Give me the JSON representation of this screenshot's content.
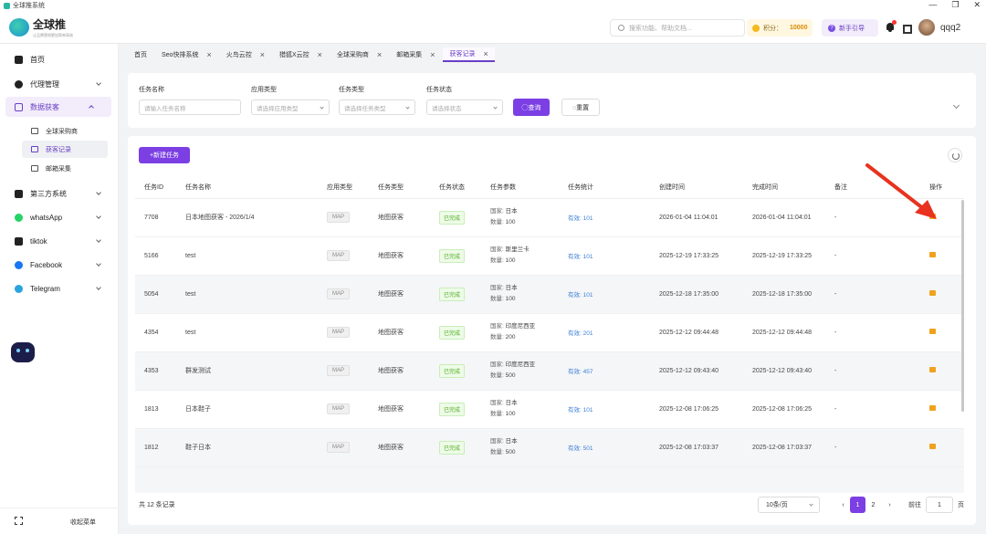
{
  "window": {
    "title": "全球推系统",
    "controls": [
      "—",
      "❐",
      "✕"
    ]
  },
  "brand": {
    "name": "全球推",
    "subtitle": "让品牌营销更加简单高效"
  },
  "header": {
    "search_placeholder": "搜索功能、帮助文档...",
    "points_label": "积分：",
    "points_value": "10000",
    "guide_label": "新手引导",
    "username": "qqq2"
  },
  "sidebar": {
    "items": [
      {
        "label": "首页"
      },
      {
        "label": "代理管理"
      },
      {
        "label": "数据获客"
      },
      {
        "label": "第三方系统"
      },
      {
        "label": "whatsApp"
      },
      {
        "label": "tiktok"
      },
      {
        "label": "Facebook"
      },
      {
        "label": "Telegram"
      }
    ],
    "subitems": [
      {
        "label": "全球采购商"
      },
      {
        "label": "获客记录"
      },
      {
        "label": "邮箱采集"
      }
    ],
    "collapse_label": "收起菜单"
  },
  "tabs": [
    {
      "label": "首页",
      "closable": false
    },
    {
      "label": "Seo快排系统",
      "closable": true
    },
    {
      "label": "火鸟云控",
      "closable": true
    },
    {
      "label": "猎狐X云控",
      "closable": true
    },
    {
      "label": "全球采购商",
      "closable": true
    },
    {
      "label": "邮箱采集",
      "closable": true
    },
    {
      "label": "获客记录",
      "closable": true
    }
  ],
  "filters": {
    "task_name": {
      "label": "任务名称",
      "placeholder": "请输入任务名称"
    },
    "app_type": {
      "label": "应用类型",
      "placeholder": "请选择应用类型"
    },
    "task_type": {
      "label": "任务类型",
      "placeholder": "请选择任务类型"
    },
    "task_status": {
      "label": "任务状态",
      "placeholder": "请选择状态"
    },
    "query_label": "◯查询",
    "reset_label": "◌重置"
  },
  "toolbar": {
    "new_task_label": "+新建任务"
  },
  "table": {
    "headers": [
      "任务ID",
      "任务名称",
      "应用类型",
      "任务类型",
      "任务状态",
      "任务参数",
      "任务统计",
      "创建时间",
      "完成时间",
      "备注",
      "操作"
    ],
    "rows": [
      {
        "id": "7708",
        "name": "日本地图获客 - 2026/1/4",
        "app": "MAP",
        "type": "地图获客",
        "status": "已完成",
        "country_k": "国家:",
        "country": "日本",
        "qty_k": "数量:",
        "qty": "100",
        "stat": "有效: 101",
        "created": "2026-01-04 11:04:01",
        "done": "2026-01-04 11:04:01",
        "note": "-"
      },
      {
        "id": "5166",
        "name": "test",
        "app": "MAP",
        "type": "地图获客",
        "status": "已完成",
        "country_k": "国家:",
        "country": "斯里兰卡",
        "qty_k": "数量:",
        "qty": "100",
        "stat": "有效: 101",
        "created": "2025-12-19 17:33:25",
        "done": "2025-12-19 17:33:25",
        "note": "-"
      },
      {
        "id": "5054",
        "name": "test",
        "app": "MAP",
        "type": "地图获客",
        "status": "已完成",
        "country_k": "国家:",
        "country": "日本",
        "qty_k": "数量:",
        "qty": "100",
        "stat": "有效: 101",
        "created": "2025-12-18 17:35:00",
        "done": "2025-12-18 17:35:00",
        "note": "-"
      },
      {
        "id": "4354",
        "name": "test",
        "app": "MAP",
        "type": "地图获客",
        "status": "已完成",
        "country_k": "国家:",
        "country": "印度尼西亚",
        "qty_k": "数量:",
        "qty": "200",
        "stat": "有效: 201",
        "created": "2025-12-12 09:44:48",
        "done": "2025-12-12 09:44:48",
        "note": "-"
      },
      {
        "id": "4353",
        "name": "群发测试",
        "app": "MAP",
        "type": "地图获客",
        "status": "已完成",
        "country_k": "国家:",
        "country": "印度尼西亚",
        "qty_k": "数量:",
        "qty": "500",
        "stat": "有效: 457",
        "created": "2025-12-12 09:43:40",
        "done": "2025-12-12 09:43:40",
        "note": "-"
      },
      {
        "id": "1813",
        "name": "日本鞋子",
        "app": "MAP",
        "type": "地图获客",
        "status": "已完成",
        "country_k": "国家:",
        "country": "日本",
        "qty_k": "数量:",
        "qty": "100",
        "stat": "有效: 101",
        "created": "2025-12-08 17:06:25",
        "done": "2025-12-08 17:06:25",
        "note": "-"
      },
      {
        "id": "1812",
        "name": "鞋子日本",
        "app": "MAP",
        "type": "地图获客",
        "status": "已完成",
        "country_k": "国家:",
        "country": "日本",
        "qty_k": "数量:",
        "qty": "500",
        "stat": "有效: 501",
        "created": "2025-12-08 17:03:37",
        "done": "2025-12-08 17:03:37",
        "note": "-"
      }
    ]
  },
  "pagination": {
    "total": "共 12 条记录",
    "page_size": "10条/页",
    "prev": "‹",
    "pages": [
      "1",
      "2"
    ],
    "next": "›",
    "goto_label": "前往",
    "goto_value": "1",
    "page_suffix": "页"
  },
  "colors": {
    "accent": "#7b3fe4",
    "arrow": "#e8321e",
    "op_icon": "#f0a21e"
  }
}
